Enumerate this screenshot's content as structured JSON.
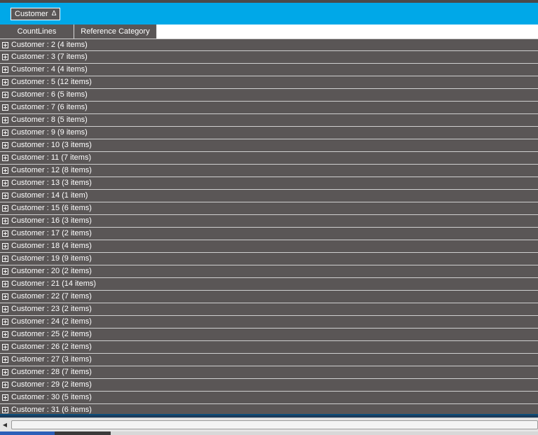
{
  "group_panel": {
    "chip_label": "Customer",
    "sort_icon": "sort-ascending-triangle-icon",
    "background_color": "#00a8e8"
  },
  "columns": [
    {
      "label": "CountLines"
    },
    {
      "label": "Reference Category"
    }
  ],
  "rows": [
    {
      "label": "Customer : 2 (4 items)"
    },
    {
      "label": "Customer : 3 (7 items)"
    },
    {
      "label": "Customer : 4 (4 items)"
    },
    {
      "label": "Customer : 5 (12 items)"
    },
    {
      "label": "Customer : 6 (5 items)"
    },
    {
      "label": "Customer : 7 (6 items)"
    },
    {
      "label": "Customer : 8 (5 items)"
    },
    {
      "label": "Customer : 9 (9 items)"
    },
    {
      "label": "Customer : 10 (3 items)"
    },
    {
      "label": "Customer : 11 (7 items)"
    },
    {
      "label": "Customer : 12 (8 items)"
    },
    {
      "label": "Customer : 13 (3 items)"
    },
    {
      "label": "Customer : 14 (1 item)"
    },
    {
      "label": "Customer : 15 (6 items)"
    },
    {
      "label": "Customer : 16 (3 items)"
    },
    {
      "label": "Customer : 17 (2 items)"
    },
    {
      "label": "Customer : 18 (4 items)"
    },
    {
      "label": "Customer : 19 (9 items)"
    },
    {
      "label": "Customer : 20 (2 items)"
    },
    {
      "label": "Customer : 21 (14 items)"
    },
    {
      "label": "Customer : 22 (7 items)"
    },
    {
      "label": "Customer : 23 (2 items)"
    },
    {
      "label": "Customer : 24 (2 items)"
    },
    {
      "label": "Customer : 25 (2 items)"
    },
    {
      "label": "Customer : 26 (2 items)"
    },
    {
      "label": "Customer : 27 (3 items)"
    },
    {
      "label": "Customer : 28 (7 items)"
    },
    {
      "label": "Customer : 29 (2 items)"
    },
    {
      "label": "Customer : 30 (5 items)"
    },
    {
      "label": "Customer : 31 (6 items)"
    }
  ],
  "row_icon": "expand-plus-icon",
  "grid_background_color": "#5a5656",
  "scrollbar": {
    "left_arrow_icon": "scroll-left-arrow-icon"
  }
}
